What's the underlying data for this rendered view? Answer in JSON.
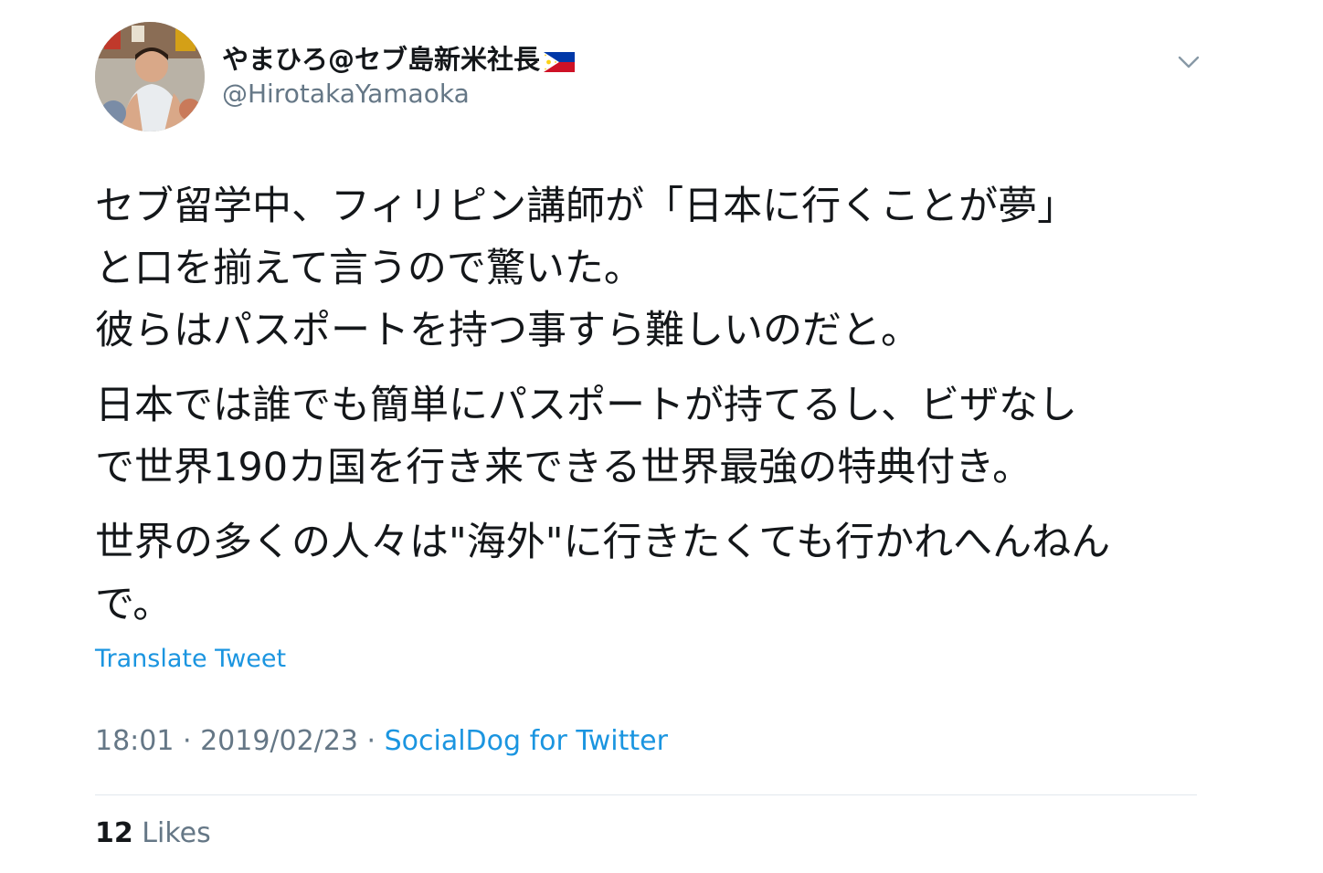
{
  "author": {
    "display_name": "やまひろ@セブ島新米社長",
    "flag_icon": "philippines-flag-icon",
    "handle": "@HirotakaYamaoka",
    "avatar_icon": "user-avatar"
  },
  "menu": {
    "icon": "chevron-down-icon"
  },
  "tweet": {
    "lines": [
      "セブ留学中、フィリピン講師が「日本に行くことが夢」",
      "と口を揃えて言うので驚いた。",
      "彼らはパスポートを持つ事すら難しいのだと。",
      "日本では誰でも簡単にパスポートが持てるし、ビザなし",
      "で世界190カ国を行き来できる世界最強の特典付き。",
      "世界の多くの人々は\"海外\"に行きたくても行かれへんねん",
      "で。"
    ]
  },
  "translate_label": "Translate Tweet",
  "meta": {
    "time": "18:01",
    "separator": " · ",
    "date": "2019/02/23",
    "source": "SocialDog for Twitter"
  },
  "stats": {
    "likes_count": "12",
    "likes_label": " Likes"
  },
  "colors": {
    "text": "#14171a",
    "secondary": "#657786",
    "link": "#1b95e0",
    "divider": "#e1e8ed"
  }
}
